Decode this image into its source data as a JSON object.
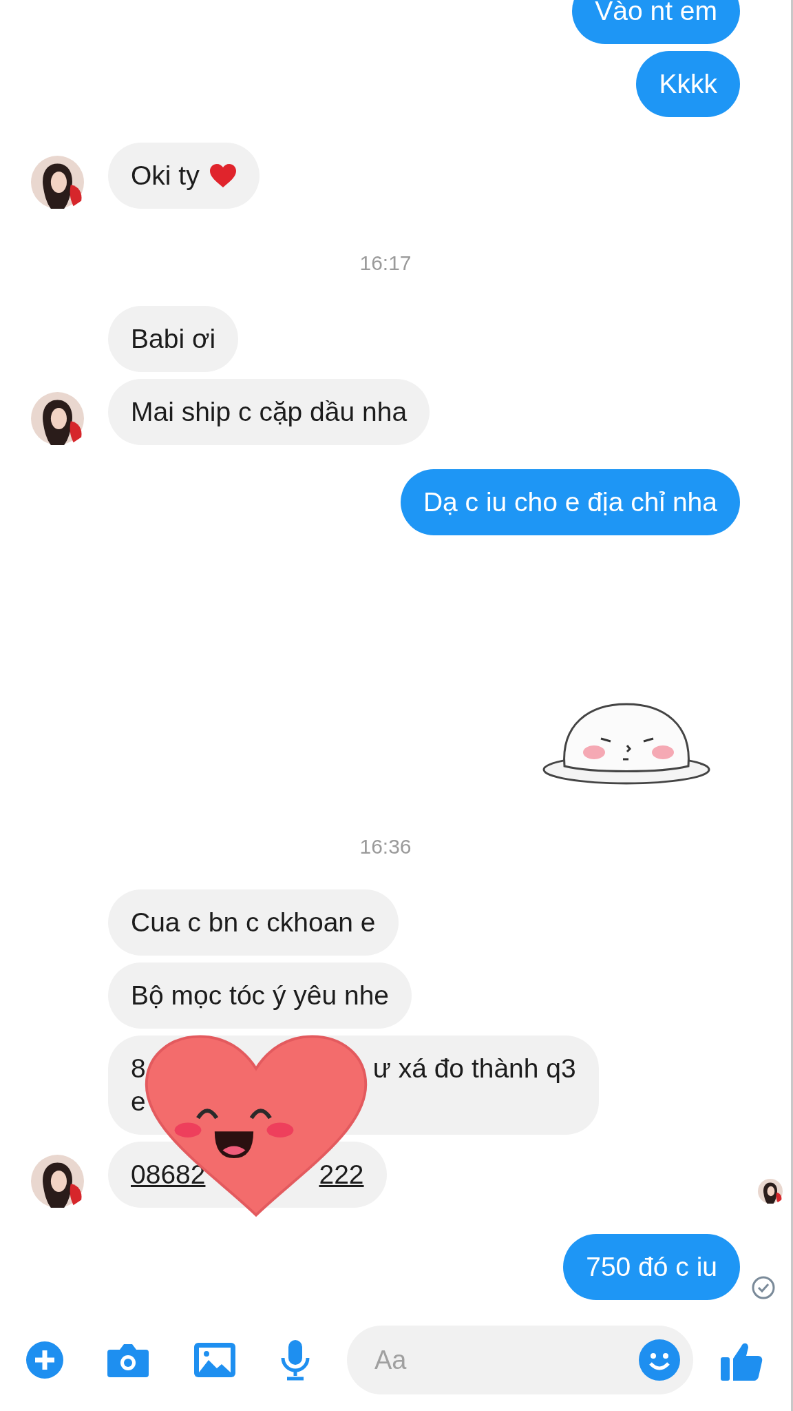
{
  "messages": [
    {
      "kind": "text",
      "outgoing": true,
      "text": "Vào nt em"
    },
    {
      "kind": "text",
      "outgoing": true,
      "text": "Kkkk"
    },
    {
      "kind": "text",
      "outgoing": false,
      "text": "Oki ty",
      "heart": true,
      "avatar": true
    },
    {
      "kind": "time",
      "text": "16:17"
    },
    {
      "kind": "text",
      "outgoing": false,
      "text": "Babi ơi",
      "avatar": false
    },
    {
      "kind": "text",
      "outgoing": false,
      "text": "Mai ship c cặp dầu nha",
      "avatar": true
    },
    {
      "kind": "text",
      "outgoing": true,
      "text": "Dạ c iu cho e địa chỉ nha"
    },
    {
      "kind": "sticker",
      "outgoing": true
    },
    {
      "kind": "time",
      "text": "16:36"
    },
    {
      "kind": "text",
      "outgoing": false,
      "text": "Cua c bn c ckhoan e",
      "avatar": false
    },
    {
      "kind": "text",
      "outgoing": false,
      "text": "Bộ mọc tóc ý yêu nhe",
      "avatar": false
    },
    {
      "kind": "covered",
      "outgoing": false,
      "lines": [
        [
          "8",
          "ư xá đo thành q3"
        ],
        [
          "e"
        ]
      ],
      "avatar": false,
      "heart_cover": true
    },
    {
      "kind": "link",
      "outgoing": false,
      "segments": [
        "08682",
        "222"
      ],
      "avatar": true,
      "seen_by": true
    },
    {
      "kind": "text",
      "outgoing": true,
      "text": "750 đó c iu",
      "delivered": true
    }
  ],
  "composer": {
    "placeholder": "Aa"
  }
}
